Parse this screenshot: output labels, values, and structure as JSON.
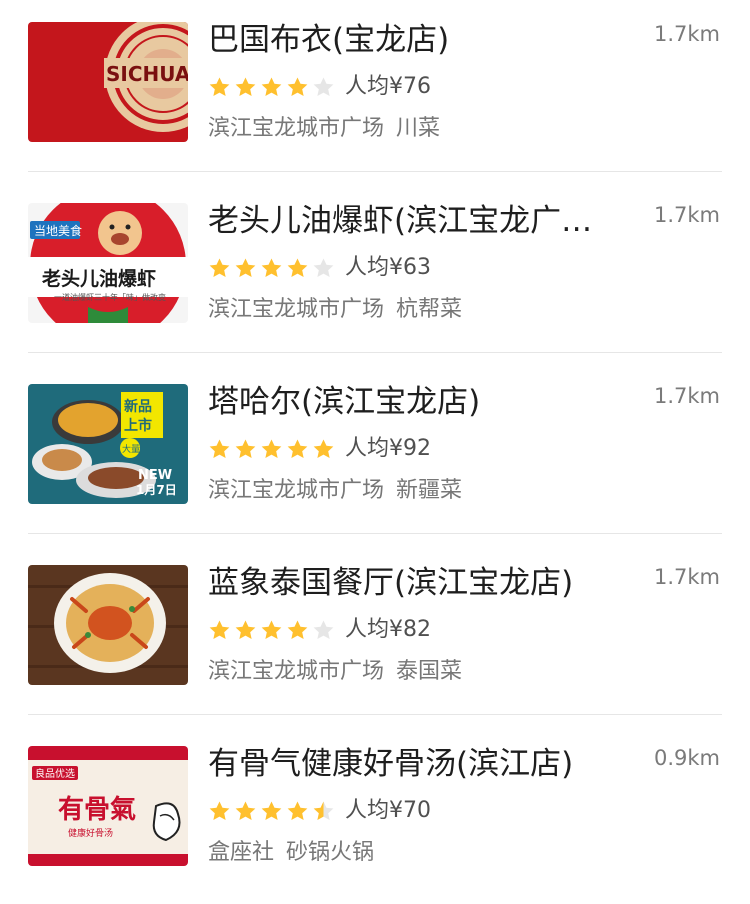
{
  "restaurants": [
    {
      "name": "巴国布衣(宝龙店)",
      "distance": "1.7km",
      "rating": 4,
      "price": "人均¥76",
      "area": "滨江宝龙城市广场",
      "cuisine": "川菜",
      "image_text": "SICHUAN"
    },
    {
      "name": "老头儿油爆虾(滨江宝龙广…",
      "distance": "1.7km",
      "rating": 4,
      "price": "人均¥63",
      "area": "滨江宝龙城市广场",
      "cuisine": "杭帮菜",
      "image_badge": "当地美食",
      "image_logo": "老头儿油爆虾",
      "image_slogan": "一道油爆虾三十年「味」做改变"
    },
    {
      "name": "塔哈尔(滨江宝龙店)",
      "distance": "1.7km",
      "rating": 5,
      "price": "人均¥92",
      "area": "滨江宝龙城市广场",
      "cuisine": "新疆菜",
      "image_title": "新品上市",
      "image_tag": "大量",
      "image_new": "NEW",
      "image_date": "1月7日"
    },
    {
      "name": "蓝象泰国餐厅(滨江宝龙店)",
      "distance": "1.7km",
      "rating": 4,
      "price": "人均¥82",
      "area": "滨江宝龙城市广场",
      "cuisine": "泰国菜"
    },
    {
      "name": "有骨气健康好骨汤(滨江店)",
      "distance": "0.9km",
      "rating": 4.5,
      "price": "人均¥70",
      "area": "盒座社",
      "cuisine": "砂锅火锅",
      "image_badge": "良品优选",
      "image_logo": "有骨氣",
      "image_slogan": "健康好骨汤"
    }
  ],
  "colors": {
    "star_on": "#FFC02E",
    "star_off": "#E6E6E6",
    "divider": "#E6E6E6"
  }
}
